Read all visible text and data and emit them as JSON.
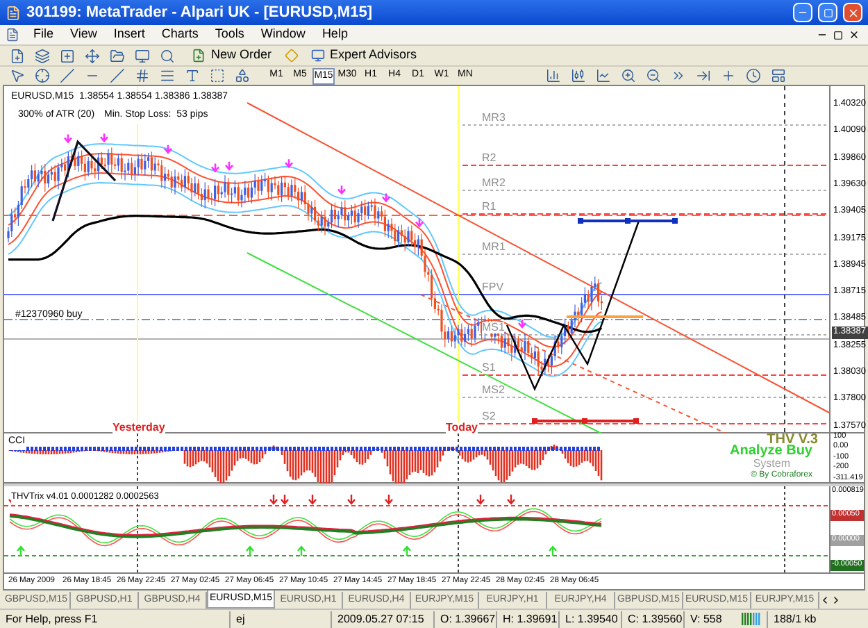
{
  "window": {
    "title": "301199: MetaTrader - Alpari UK - [EURUSD,M15]"
  },
  "menu": [
    "File",
    "View",
    "Insert",
    "Charts",
    "Tools",
    "Window",
    "Help"
  ],
  "toolbar": {
    "buttons": [
      "New Order",
      "Expert Advisors"
    ],
    "periods": [
      {
        "label": "M1",
        "selected": false
      },
      {
        "label": "M5",
        "selected": false
      },
      {
        "label": "M15",
        "selected": true
      },
      {
        "label": "M30",
        "selected": false
      },
      {
        "label": "H1",
        "selected": false
      },
      {
        "label": "H4",
        "selected": false
      },
      {
        "label": "D1",
        "selected": false
      },
      {
        "label": "W1",
        "selected": false
      },
      {
        "label": "MN",
        "selected": false
      }
    ]
  },
  "chart": {
    "header": "EURUSD,M15  1.38554 1.38554 1.38386 1.38387",
    "atr": "300% of ATR (20)",
    "stop_loss": "Min. Stop Loss:  53 pips",
    "order": "#12370960 buy",
    "yesterday": "Yesterday",
    "today": "Today",
    "levels": [
      {
        "label": "MR3",
        "kind": "mid"
      },
      {
        "label": "R2",
        "kind": "resistance"
      },
      {
        "label": "MR2",
        "kind": "mid"
      },
      {
        "label": "R1",
        "kind": "resistance"
      },
      {
        "label": "MR1",
        "kind": "mid"
      },
      {
        "label": "FPV",
        "kind": "pivot"
      },
      {
        "label": "MS1",
        "kind": "mid"
      },
      {
        "label": "S1",
        "kind": "support"
      },
      {
        "label": "MS2",
        "kind": "mid"
      },
      {
        "label": "S2",
        "kind": "support"
      }
    ],
    "price_axis": [
      {
        "label": "1.40320",
        "kind": "tick"
      },
      {
        "label": "1.40090",
        "kind": "tick"
      },
      {
        "label": "1.39860",
        "kind": "tick"
      },
      {
        "label": "1.39630",
        "kind": "tick"
      },
      {
        "label": "1.39405",
        "kind": "tick"
      },
      {
        "label": "1.39175",
        "kind": "tick"
      },
      {
        "label": "1.38945",
        "kind": "tick"
      },
      {
        "label": "1.38715",
        "kind": "tick"
      },
      {
        "label": "1.38485",
        "kind": "tick"
      },
      {
        "label": "1.38387",
        "kind": "current"
      },
      {
        "label": "1.38255",
        "kind": "tick"
      },
      {
        "label": "1.38030",
        "kind": "tick"
      },
      {
        "label": "1.37800",
        "kind": "tick"
      },
      {
        "label": "1.37570",
        "kind": "tick"
      }
    ],
    "cci": {
      "label": "CCI",
      "axis": [
        "100",
        "0.00",
        "-100",
        "-200",
        "-311.419"
      ],
      "badge_title": "THV V.3",
      "badge_signal": "Analyze Buy",
      "badge_system": "System",
      "badge_credit": "© By Cobraforex"
    },
    "thv": {
      "label": "THVTrix v4.01 0.0001282 0.0002563",
      "axis": [
        {
          "label": "0.000819"
        },
        {
          "label": "0.00050",
          "color": "#c03030"
        },
        {
          "label": "0.00000",
          "color": "#a0a0a0"
        },
        {
          "label": "-0.00050",
          "color": "#207020"
        }
      ]
    },
    "time_axis": [
      "26 May 2009",
      "26 May 18:45",
      "26 May 22:45",
      "27 May 02:45",
      "27 May 06:45",
      "27 May 10:45",
      "27 May 14:45",
      "27 May 18:45",
      "27 May 22:45",
      "28 May 02:45",
      "28 May 06:45"
    ]
  },
  "tabs": [
    {
      "label": "GBPUSD,M15",
      "selected": false
    },
    {
      "label": "GBPUSD,H1",
      "selected": false
    },
    {
      "label": "GBPUSD,H4",
      "selected": false
    },
    {
      "label": "EURUSD,M15",
      "selected": true
    },
    {
      "label": "EURUSD,H1",
      "selected": false
    },
    {
      "label": "EURUSD,H4",
      "selected": false
    },
    {
      "label": "EURJPY,M15",
      "selected": false
    },
    {
      "label": "EURJPY,H1",
      "selected": false
    },
    {
      "label": "EURJPY,H4",
      "selected": false
    },
    {
      "label": "GBPUSD,M15",
      "selected": false
    },
    {
      "label": "EURUSD,M15",
      "selected": false
    },
    {
      "label": "EURJPY,M15",
      "selected": false
    }
  ],
  "status_bar": {
    "help": "For Help, press F1",
    "profile": "ej",
    "time": "2009.05.27 07:15",
    "open": "O: 1.39667",
    "high": "H: 1.39691",
    "low": "L: 1.39540",
    "close": "C: 1.39560",
    "volume": "V: 558",
    "traffic": "188/1 kb"
  }
}
